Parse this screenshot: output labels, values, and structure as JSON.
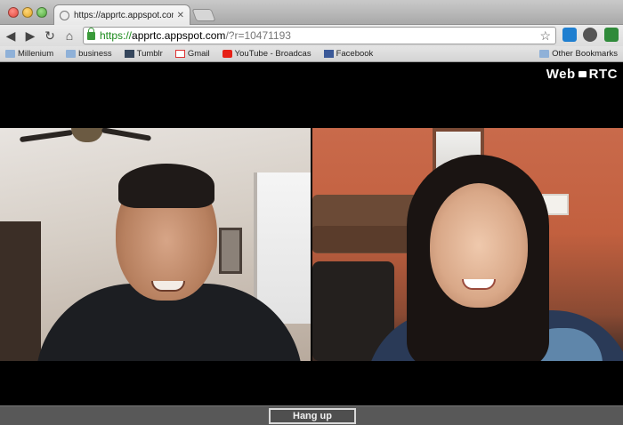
{
  "browser": {
    "tab": {
      "title": "https://apprtc.appspot.com",
      "favicon": "globe-icon"
    },
    "url": {
      "scheme": "https://",
      "host": "apprtc.appspot.com",
      "path": "/?r=10471193"
    },
    "bookmarks": [
      {
        "label": "Millenium",
        "icon": "folder-icon"
      },
      {
        "label": "business",
        "icon": "folder-icon"
      },
      {
        "label": "Tumblr",
        "icon": "tumblr-icon"
      },
      {
        "label": "Gmail",
        "icon": "gmail-icon"
      },
      {
        "label": "YouTube - Broadcas",
        "icon": "youtube-icon"
      },
      {
        "label": "Facebook",
        "icon": "facebook-icon"
      }
    ],
    "other_bookmarks": "Other Bookmarks"
  },
  "page": {
    "logo": {
      "left": "Web",
      "right": "RTC"
    },
    "videos": {
      "local": {
        "icon": "video-feed"
      },
      "remote": {
        "icon": "video-feed"
      }
    },
    "hangup_label": "Hang up"
  },
  "colors": {
    "background": "#000000",
    "footer": "#585858",
    "url_green": "#1a8a1a"
  }
}
